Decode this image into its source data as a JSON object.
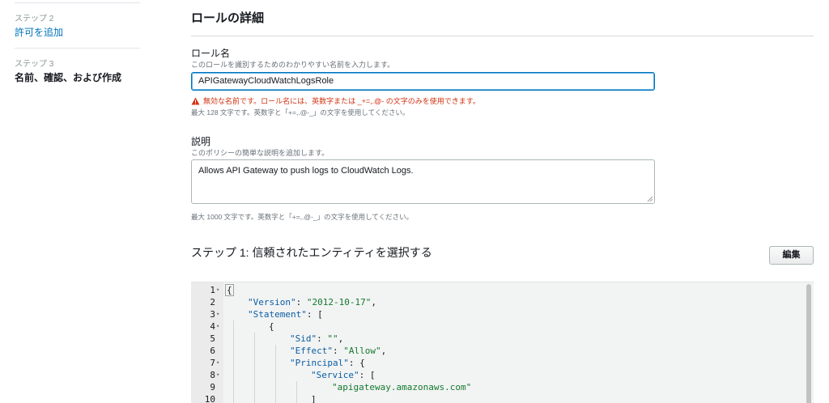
{
  "steps": [
    {
      "label": "ステップ 2",
      "title": "許可を追加"
    },
    {
      "label": "ステップ 3",
      "title": "名前、確認、および作成"
    }
  ],
  "section": {
    "title": "ロールの詳細"
  },
  "role_name": {
    "label": "ロール名",
    "description": "このロールを識別するためのわかりやすい名前を入力します。",
    "value": "APIGatewayCloudWatchLogsRole",
    "error": "無効な名前です。ロール名には、英数字または _+=,.@- の文字のみを使用できます。",
    "help": "最大 128 文字です。英数字と「+=,.@-_」の文字を使用してください。"
  },
  "description_field": {
    "label": "説明",
    "description": "このポリシーの簡単な説明を追加します。",
    "value": "Allows API Gateway to push logs to CloudWatch Logs.",
    "help": "最大 1000 文字です。英数字と「+=,.@-_」の文字を使用してください。"
  },
  "trust": {
    "title": "ステップ 1: 信頼されたエンティティを選択する",
    "edit_label": "編集"
  },
  "editor": {
    "lines": [
      {
        "n": "1",
        "fold": true,
        "indent": 0,
        "text": "{"
      },
      {
        "n": "2",
        "fold": false,
        "indent": 1,
        "key": "\"Version\"",
        "rest": ": ",
        "str": "\"2012-10-17\"",
        "tail": ","
      },
      {
        "n": "3",
        "fold": true,
        "indent": 1,
        "key": "\"Statement\"",
        "rest": ": [",
        "str": "",
        "tail": ""
      },
      {
        "n": "4",
        "fold": true,
        "indent": 2,
        "text": "{"
      },
      {
        "n": "5",
        "fold": false,
        "indent": 3,
        "key": "\"Sid\"",
        "rest": ": ",
        "str": "\"\"",
        "tail": ","
      },
      {
        "n": "6",
        "fold": false,
        "indent": 3,
        "key": "\"Effect\"",
        "rest": ": ",
        "str": "\"Allow\"",
        "tail": ","
      },
      {
        "n": "7",
        "fold": true,
        "indent": 3,
        "key": "\"Principal\"",
        "rest": ": {",
        "str": "",
        "tail": ""
      },
      {
        "n": "8",
        "fold": true,
        "indent": 4,
        "key": "\"Service\"",
        "rest": ": [",
        "str": "",
        "tail": ""
      },
      {
        "n": "9",
        "fold": false,
        "indent": 5,
        "key": "",
        "rest": "",
        "str": "\"apigateway.amazonaws.com\"",
        "tail": ""
      },
      {
        "n": "10",
        "fold": false,
        "indent": 4,
        "text": "]"
      }
    ]
  },
  "colors": {
    "link": "#0073bb",
    "error": "#d13212",
    "json_key": "#0b5fa5",
    "json_string": "#137a2e"
  }
}
